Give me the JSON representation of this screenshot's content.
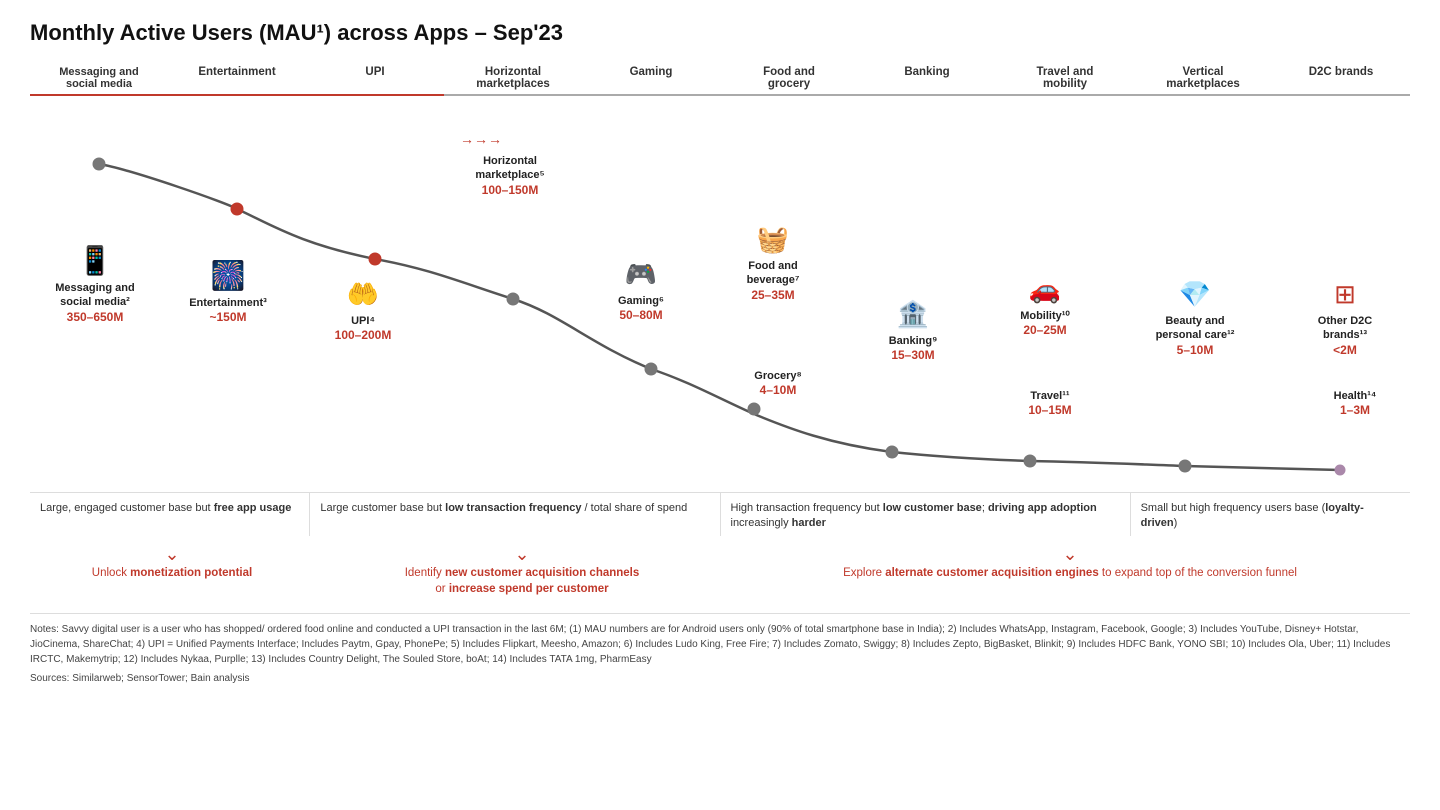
{
  "title": "Monthly Active Users (MAU¹) across Apps – Sep'23",
  "categories": [
    {
      "label": "Messaging and\nsocial media",
      "underline": "red"
    },
    {
      "label": "Entertainment",
      "underline": "red"
    },
    {
      "label": "UPI",
      "underline": "red"
    },
    {
      "label": "Horizontal\nmarketplaces",
      "underline": "gray"
    },
    {
      "label": "Gaming",
      "underline": "gray"
    },
    {
      "label": "Food and\ngrocery",
      "underline": "gray"
    },
    {
      "label": "Banking",
      "underline": "gray"
    },
    {
      "label": "Travel and\nmobility",
      "underline": "gray"
    },
    {
      "label": "Vertical\nmarketplaces",
      "underline": "gray"
    },
    {
      "label": "D2C brands",
      "underline": "gray"
    }
  ],
  "data_points": [
    {
      "label": "Messaging and\nsocial media²",
      "value": "350–650M",
      "icon": "📱",
      "note": ""
    },
    {
      "label": "Entertainment³",
      "value": "~150M",
      "icon": "🎆",
      "note": ""
    },
    {
      "label": "UPI⁴",
      "value": "100–200M",
      "icon": "🤲",
      "note": ""
    },
    {
      "label": "Horizontal\nmarketplace⁵",
      "value": "100–150M",
      "icon": "🛒",
      "note": ""
    },
    {
      "label": "Gaming⁶",
      "value": "50–80M",
      "icon": "🎮",
      "note": ""
    },
    {
      "label": "Food and\nbeverage⁷",
      "value": "25–35M",
      "icon": "🧺",
      "note": ""
    },
    {
      "label": "Grocery⁸",
      "value": "4–10M",
      "icon": "",
      "note": ""
    },
    {
      "label": "Banking⁹",
      "value": "15–30M",
      "icon": "🏦",
      "note": ""
    },
    {
      "label": "Mobility¹⁰",
      "value": "20–25M",
      "icon": "🚗",
      "note": ""
    },
    {
      "label": "Travel¹¹",
      "value": "10–15M",
      "icon": "",
      "note": ""
    },
    {
      "label": "Beauty and\npersonal care¹²",
      "value": "5–10M",
      "icon": "💎",
      "note": ""
    },
    {
      "label": "Other D2C\nbrands¹³",
      "value": "<2M",
      "icon": "⊞",
      "note": ""
    },
    {
      "label": "Health¹⁴",
      "value": "1–3M",
      "icon": "",
      "note": ""
    }
  ],
  "bottom_descriptions": [
    {
      "text": "Large, engaged customer base but free app usage",
      "highlight_words": [
        "free app usage"
      ]
    },
    {
      "text": "Large customer base but low transaction frequency / total share of spend",
      "highlight_words": [
        "low transaction frequency"
      ]
    },
    {
      "text": "High transaction frequency but low customer base; driving app adoption increasingly harder",
      "highlight_words": [
        "low customer base",
        "driving app adoption",
        "harder"
      ]
    },
    {
      "text": "Small but high frequency users base (loyalty-driven)",
      "highlight_words": [
        "loyalty-driven"
      ]
    }
  ],
  "insights": [
    {
      "text": "Unlock monetization potential",
      "bold_words": [
        "monetization potential"
      ]
    },
    {
      "text": "Identify new customer acquisition channels or increase spend per customer",
      "bold_words": [
        "new customer acquisition channels",
        "increase spend per customer"
      ]
    },
    {
      "text": "Explore alternate customer acquisition engines to expand top of the conversion funnel",
      "bold_words": [
        "alternate customer acquisition engines"
      ]
    }
  ],
  "notes": "Notes: Savvy digital user is a user who has shopped/ ordered food online and conducted a UPI transaction in the last 6M; (1) MAU numbers are for Android users only (90% of total smartphone base in India); 2) Includes WhatsApp, Instagram, Facebook, Google; 3) Includes YouTube, Disney+ Hotstar, JioCinema, ShareChat; 4) UPI = Unified Payments Interface; Includes Paytm, Gpay, PhonePe; 5) Includes Flipkart, Meesho, Amazon; 6) Includes Ludo King, Free Fire; 7) Includes Zomato, Swiggy; 8) Includes Zepto, BigBasket, Blinkit; 9) Includes HDFC Bank, YONO SBI; 10) Includes Ola, Uber; 11) Includes IRCTC, Makemytrip; 12) Includes Nykaa, Purplle; 13) Includes Country Delight, The Souled Store, boAt; 14) Includes TATA 1mg, PharmEasy",
  "sources": "Sources: Similarweb; SensorTower; Bain analysis"
}
